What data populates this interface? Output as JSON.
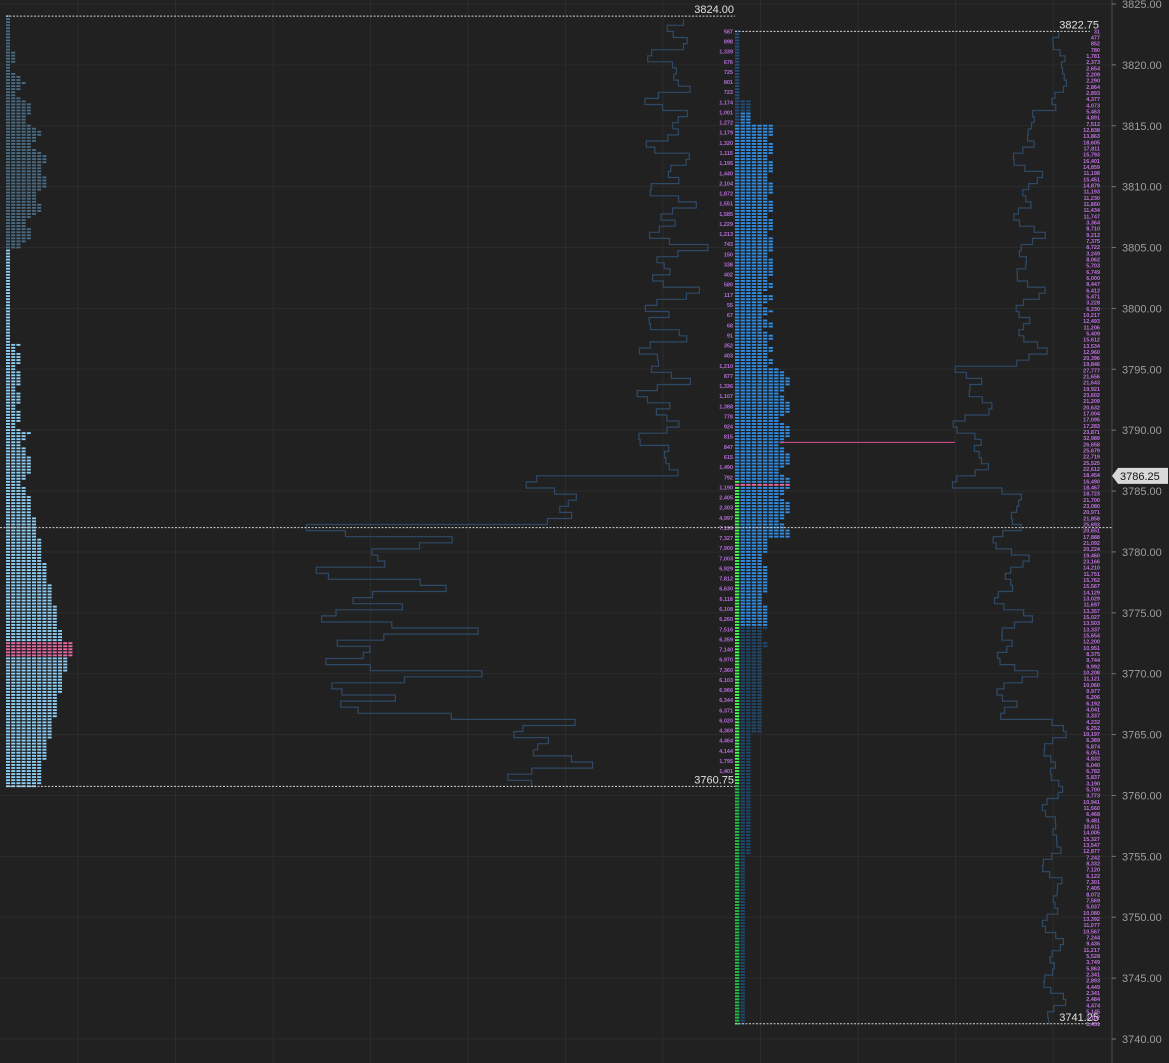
{
  "y_axis": {
    "min": 3740,
    "max": 3825,
    "ticks": [
      "3740.00",
      "3745.00",
      "3750.00",
      "3755.00",
      "3760.00",
      "3765.00",
      "3770.00",
      "3775.00",
      "3780.00",
      "3785.00",
      "3790.00",
      "3795.00",
      "3800.00",
      "3805.00",
      "3810.00",
      "3815.00",
      "3820.00",
      "3825.00"
    ]
  },
  "reference_lines": [
    {
      "label": "3824.00",
      "price": 3824.0
    },
    {
      "label": "3822.75",
      "price": 3822.75
    },
    {
      "label": "3760.75",
      "price": 3760.75
    },
    {
      "label": "3741.25",
      "price": 3741.25
    }
  ],
  "current_price": {
    "label": "3786.25",
    "price": 3786.25
  },
  "profiles": [
    {
      "name": "profile-1",
      "range": [
        3760.75,
        3824.0
      ],
      "poc": 3772.0,
      "value_area_split": 3805.0,
      "colors": {
        "upper": "#4a6d87",
        "lower": "#8fcff6",
        "poc": "#e86aa5"
      }
    },
    {
      "name": "profile-2",
      "range": [
        3741.25,
        3822.75
      ],
      "poc": 3785.5,
      "colors": {
        "main": "#2f8fe8",
        "upper": "#244f7a",
        "lower": "#1e4a72",
        "green": "#22c045",
        "bright_green": "#44ff5a",
        "poc": "#e86aa5"
      }
    }
  ],
  "volume_labels_left": [
    "587",
    "898",
    "1,339",
    "676",
    "725",
    "801",
    "723",
    "1,174",
    "1,001",
    "1,272",
    "1,179",
    "1,320",
    "1,115",
    "1,195",
    "1,440",
    "2,104",
    "1,872",
    "1,551",
    "1,585",
    "1,229",
    "1,213",
    "743",
    "150",
    "338",
    "402",
    "580",
    "117",
    "55",
    "67",
    "68",
    "91",
    "352",
    "403",
    "1,210",
    "877",
    "1,336",
    "1,107",
    "1,388",
    "778",
    "924",
    "815",
    "847",
    "615",
    "1,490",
    "792",
    "1,190",
    "2,405",
    "2,303",
    "4,997",
    "7,199",
    "7,327",
    "7,900",
    "7,003",
    "6,929",
    "7,812",
    "6,630",
    "6,118",
    "6,108",
    "6,260",
    "7,516",
    "6,359",
    "7,140",
    "6,970",
    "7,360",
    "6,103",
    "6,966",
    "6,344",
    "6,371",
    "6,020",
    "4,369",
    "4,464",
    "4,144",
    "1,795",
    "1,401"
  ],
  "volume_labels_right": [
    "31",
    "477",
    "852",
    "780",
    "1,781",
    "2,373",
    "2,654",
    "2,209",
    "2,290",
    "2,864",
    "2,893",
    "4,377",
    "4,073",
    "5,463",
    "4,891",
    "7,512",
    "12,838",
    "13,863",
    "18,605",
    "17,811",
    "15,793",
    "16,401",
    "14,859",
    "11,198",
    "15,451",
    "14,879",
    "11,193",
    "11,230",
    "11,860",
    "11,434",
    "11,747",
    "3,364",
    "8,710",
    "9,212",
    "7,375",
    "8,722",
    "3,249",
    "8,062",
    "5,703",
    "6,749",
    "6,000",
    "8,447",
    "6,412",
    "5,471",
    "3,228",
    "6,230",
    "10,217",
    "12,493",
    "11,206",
    "5,409",
    "15,612",
    "13,534",
    "12,960",
    "20,396",
    "19,846",
    "27,777",
    "21,656",
    "21,643",
    "19,921",
    "23,602",
    "21,209",
    "20,632",
    "17,004",
    "17,095",
    "17,283",
    "23,871",
    "32,989",
    "26,658",
    "25,679",
    "22,719",
    "25,525",
    "22,612",
    "18,454",
    "16,490",
    "18,467",
    "18,723",
    "21,700",
    "23,080",
    "20,971",
    "21,858",
    "25,693",
    "20,651",
    "17,888",
    "21,092",
    "20,224",
    "19,460",
    "23,166",
    "14,210",
    "11,751",
    "15,762",
    "15,567",
    "14,129",
    "13,029",
    "11,697",
    "13,357",
    "15,027",
    "13,503",
    "13,337",
    "15,654",
    "12,200",
    "10,951",
    "8,375",
    "9,744",
    "9,992",
    "10,208",
    "11,121",
    "10,060",
    "9,977",
    "6,206",
    "6,192",
    "4,041",
    "3,337",
    "4,232",
    "6,252",
    "10,197",
    "6,389",
    "5,874",
    "6,051",
    "4,832",
    "6,040",
    "6,782",
    "5,837",
    "3,190",
    "5,700",
    "3,773",
    "10,941",
    "11,560",
    "6,468",
    "9,481",
    "10,611",
    "14,005",
    "15,327",
    "13,547",
    "12,877",
    "7,242",
    "8,332",
    "7,120",
    "6,122",
    "7,301",
    "7,405",
    "8,072",
    "7,569",
    "5,037",
    "10,080",
    "13,392",
    "11,077",
    "10,567",
    "7,244",
    "9,436",
    "11,217",
    "5,528",
    "3,749",
    "5,863",
    "2,341",
    "2,893",
    "4,449",
    "2,341",
    "2,484",
    "4,474",
    "5,145",
    "2,107",
    "1,451"
  ]
}
